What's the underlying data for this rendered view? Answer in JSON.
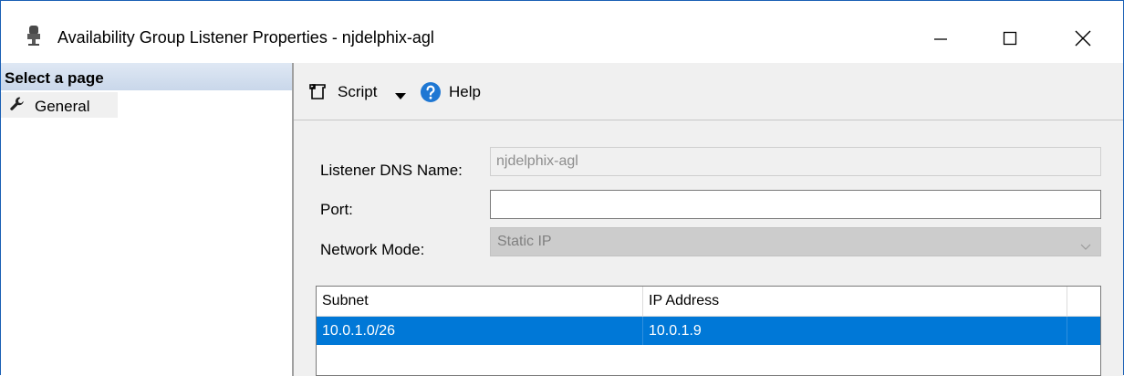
{
  "window": {
    "title": "Availability Group Listener Properties - njdelphix-agl",
    "icon": "sql-server-icon",
    "controls": {
      "minimize": "minimize-icon",
      "maximize": "maximize-icon",
      "close": "close-icon"
    }
  },
  "sidebar": {
    "header": "Select a page",
    "items": [
      {
        "label": "General",
        "icon": "wrench-icon",
        "selected": true
      }
    ]
  },
  "toolbar": {
    "script_label": "Script",
    "help_label": "Help",
    "script_icon": "script-icon",
    "help_icon": "help-icon"
  },
  "form": {
    "dns_label": "Listener DNS Name:",
    "dns_value": "njdelphix-agl",
    "port_label": "Port:",
    "port_value": "",
    "mode_label": "Network Mode:",
    "mode_value": "Static IP"
  },
  "grid": {
    "columns": [
      "Subnet",
      "IP Address"
    ],
    "rows": [
      {
        "subnet": "10.0.1.0/26",
        "ip": "10.0.1.9",
        "selected": true
      }
    ]
  },
  "colors": {
    "selection": "#0078d7",
    "help_blue": "#1e77d3",
    "window_border": "#1a5fb4"
  }
}
